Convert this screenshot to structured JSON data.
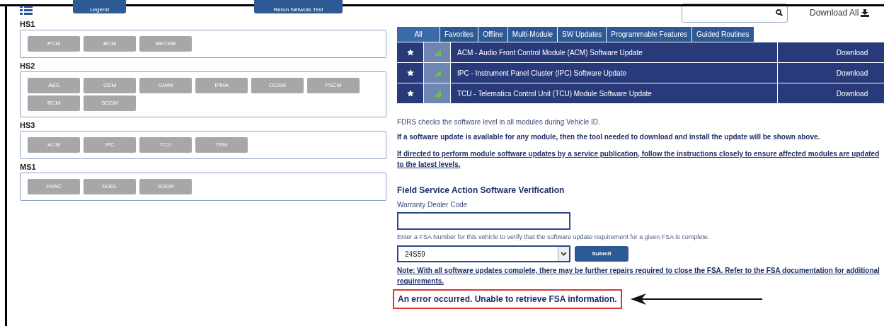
{
  "top_buttons": [
    "Legend",
    "Rerun Network Test"
  ],
  "groups": [
    {
      "name": "HS1",
      "modules": [
        "PCM",
        "BCM",
        "BECMB"
      ]
    },
    {
      "name": "HS2",
      "modules": [
        "ABS",
        "GSM",
        "GWM",
        "IPMA",
        "OCSM",
        "PSCM",
        "RCM",
        "SCCM"
      ]
    },
    {
      "name": "HS3",
      "modules": [
        "ACM",
        "IPC",
        "TCU",
        "TRM"
      ]
    },
    {
      "name": "MS1",
      "modules": [
        "HVAC",
        "SODL",
        "SODR"
      ]
    }
  ],
  "download_all": "Download All",
  "tabs": [
    {
      "label": "All",
      "selected": true
    },
    {
      "label": "Favorites",
      "selected": false
    },
    {
      "label": "Offline",
      "selected": false
    },
    {
      "label": "Multi-Module",
      "selected": false
    },
    {
      "label": "SW Updates",
      "selected": false
    },
    {
      "label": "Programmable Features",
      "selected": false
    },
    {
      "label": "Guided Routines",
      "selected": false
    }
  ],
  "rows": [
    {
      "title": "ACM - Audio Front Control Module (ACM) Software Update",
      "action": "Download"
    },
    {
      "title": "IPC - Instrument Panel Cluster (IPC) Software Update",
      "action": "Download"
    },
    {
      "title": "TCU - Telematics Control Unit (TCU) Module Software Update",
      "action": "Download"
    }
  ],
  "info": "FDRS checks the software level in all modules during Vehicle ID.",
  "info_bold": "If a software update is available for any module, then the tool needed to download and install the update will be shown above.",
  "info_link": "If directed to perform module software updates by a service publication, follow the instructions closely to ensure affected modules are updated to the latest levels.",
  "fsa": {
    "heading": "Field Service Action Software Verification",
    "dealer_label": "Warranty Dealer Code",
    "hint": "Enter a FSA Number for this vehicle to verify that the software update requirement for a given FSA is complete.",
    "fsa_value": "24S59",
    "submit": "Submit",
    "note": "Note: With all software updates complete, there may be further repairs required to close the FSA. Refer to the FSA documentation for additional requirements.",
    "error": "An error occurred. Unable to retrieve FSA information."
  }
}
